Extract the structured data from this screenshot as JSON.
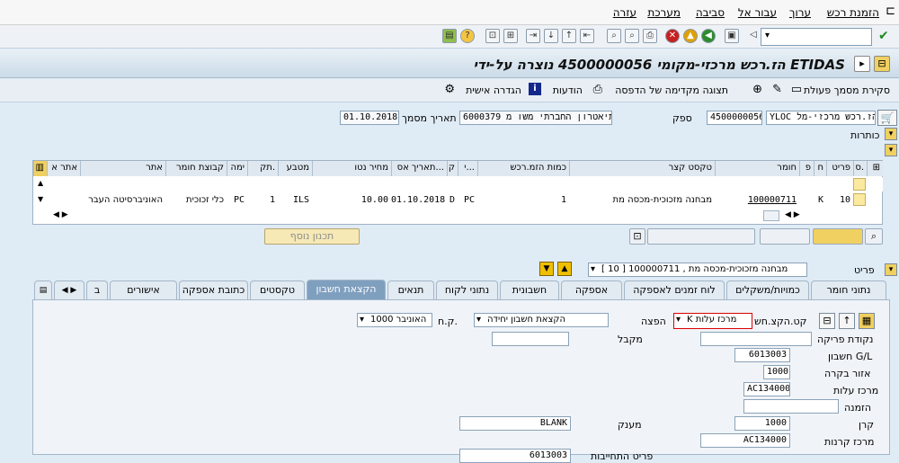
{
  "menu": [
    "הזמנת רכש",
    "ערוך",
    "עבור אל",
    "סביבה",
    "מערכת",
    "עזרה"
  ],
  "title": "הז.רכש מרכזי-מקומי 4500000056 נוצרה על-ידי ETIDAS",
  "app_toolbar": {
    "close_doc": "סקירת מסמך פעולת",
    "print_preview": "תצוגה מקדימה של הדפסה",
    "messages": "הודעות",
    "personal_settings": "הגדרה אישית"
  },
  "header": {
    "doc_type": "YLOC הז.רכש מרכזי-מל",
    "po_number": "4500000056",
    "vendor_label": "ספק",
    "vendor_value": "6000379 התיאטרון החברתי משו מ",
    "doc_date_label": "תאריך מסמך",
    "doc_date_value": "01.10.2018",
    "headers_label": "כותרות"
  },
  "items_table": {
    "columns": [
      "ס.",
      "פריט",
      "ח",
      "פ",
      "חומר",
      "טקסט קצר",
      "כמות הזמ.רכש",
      "י...",
      "ק",
      "תאריך אס...",
      "מחיר נטו",
      "מטבע",
      "תק.",
      "ימה",
      "קבוצת חומר",
      "אתר",
      "אתר א"
    ],
    "row": {
      "item": "10",
      "cat": "K",
      "material": "100000711",
      "short_text": "מבחנה מזכוכית-מכסה מת",
      "qty": "1",
      "unit": "PC",
      "date_cat": "D",
      "delivery_date": "01.10.2018",
      "net_price": "10.00",
      "currency": "ILS",
      "per": "1",
      "opu": "PC",
      "mat_group": "כלי זכוכית",
      "plant": "האוניברסיטה העבר"
    }
  },
  "additional_planning": "תכנון נוסף",
  "item_selector": {
    "label": "פריט",
    "value": "[ 10 ] 100000711 , מבחנה מזכוכית-מכסה מת"
  },
  "tabs": [
    "נתוני חומר",
    "כמויות/משקלים",
    "לוח זמנים לאספקה",
    "אספקה",
    "חשבונית",
    "נתוני לקוח",
    "תנאים",
    "הקצאת חשבון",
    "טקסטים",
    "כתובת אספקה",
    "אישורים",
    "ב"
  ],
  "active_tab": "הקצאת חשבון",
  "account_assignment": {
    "acct_cat_label": "קט.הקצ.חש",
    "acct_cat_value": "K מרכז עלות",
    "distribution_label": "הפצה",
    "distribution_value": "הקצאת חשבון יחידה",
    "cocode_label": "ק.ח.",
    "cocode_value": "1000 האוניבר",
    "unloading_label": "נקודת פריקה",
    "recipient_label": "מקבל",
    "gl_label": "חשבון G/L",
    "gl_value": "6013003",
    "business_area_label": "אזור בקרה",
    "business_area_value": "1000",
    "cost_center_label": "מרכז עלות",
    "cost_center_value": "AC134000",
    "order_label": "הזמנה",
    "fund_label": "קרן",
    "fund_value": "1000",
    "grant_label": "מענק",
    "grant_value": "BLANK",
    "funds_center_label": "מרכז קרנות",
    "funds_center_value": "AC134000",
    "commitment_label": "פריט התחייבות",
    "commitment_value": "6013003"
  }
}
